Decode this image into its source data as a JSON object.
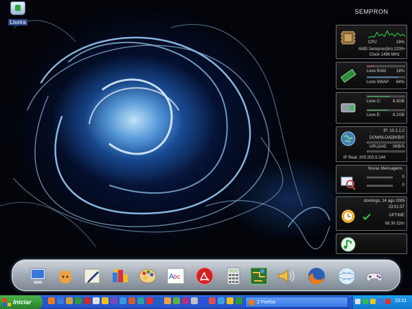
{
  "desktop": {
    "icon_label": "Lixeira"
  },
  "sidebar": {
    "title": "SEMPRON",
    "cpu": {
      "label": "CPU",
      "value": "18%",
      "model": "AMD Sempron(tm) 2200+",
      "clock": "Clock 1496 MHz"
    },
    "memory": {
      "ram_label": "Livre RAM",
      "ram_value": "18%",
      "swap_label": "Livre SWAP",
      "swap_value": "84%"
    },
    "disks": {
      "c_label": "Livre C:",
      "c_value": "8.3GB",
      "e_label": "Livre E:",
      "e_value": "8.2GB"
    },
    "network": {
      "ip_local": "IP: 10.1.1.2",
      "download_label": "DOWNLOAD",
      "download_value": "0KB/S",
      "upload_label": "UPLOAD",
      "upload_value": "0KB/S",
      "ip_real": "IP Real: 200.203.5.144"
    },
    "mail": {
      "title": "Novas Mensagens",
      "count1": "0",
      "count2": "0"
    },
    "time": {
      "date": "domingo, 14 ago 2005",
      "time": "23:01:37",
      "uptime_label": "UPTIME",
      "uptime_value": "0d 3h 22m"
    }
  },
  "dock": {
    "items": [
      "computer-icon",
      "cat-icon",
      "pen-icon",
      "music-icon",
      "palette-icon",
      "abc-icon",
      "acrobat-icon",
      "calculator-icon",
      "network-icon",
      "speaker-icon",
      "firefox-icon",
      "globe-icon",
      "gamepad-icon"
    ]
  },
  "taskbar": {
    "start_label": "Iniciar",
    "task_label": "2 Firefox",
    "clock": "23:01",
    "colors": {
      "taskbar": "#2456cf",
      "start": "#379b37",
      "tray": "#158ae0"
    }
  }
}
